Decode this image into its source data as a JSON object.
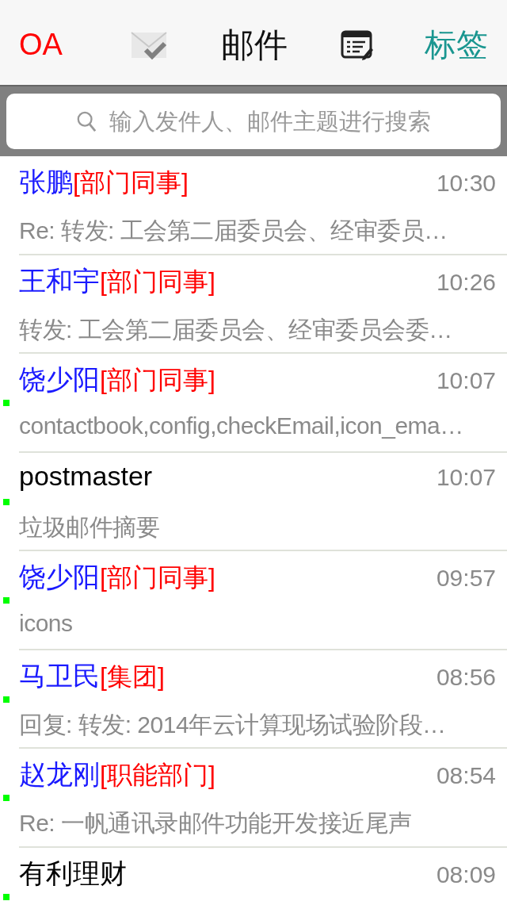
{
  "header": {
    "left": "OA",
    "title": "邮件",
    "right": "标签"
  },
  "search": {
    "placeholder": "输入发件人、邮件主题进行搜索"
  },
  "mails": [
    {
      "sender": "张鹏",
      "kind": "colleague",
      "tag": "[部门同事]",
      "time": "10:30",
      "preview": "Re: 转发: 工会第二届委员会、经审委员…",
      "unread": false
    },
    {
      "sender": "王和宇",
      "kind": "colleague",
      "tag": "[部门同事]",
      "time": "10:26",
      "preview": "转发: 工会第二届委员会、经审委员会委…",
      "unread": false
    },
    {
      "sender": "饶少阳",
      "kind": "colleague",
      "tag": "[部门同事]",
      "time": "10:07",
      "preview": "contactbook,config,checkEmail,icon_ema…",
      "unread": true
    },
    {
      "sender": "postmaster",
      "kind": "external",
      "time": "10:07",
      "preview": "垃圾邮件摘要",
      "unread": true
    },
    {
      "sender": "饶少阳",
      "kind": "colleague",
      "tag": "[部门同事]",
      "time": "09:57",
      "preview": "icons",
      "unread": true
    },
    {
      "sender": "马卫民",
      "kind": "colleague",
      "tag": "[集团]",
      "time": "08:56",
      "preview": "回复: 转发: 2014年云计算现场试验阶段…",
      "unread": true
    },
    {
      "sender": "赵龙刚",
      "kind": "colleague",
      "tag": "[职能部门]",
      "time": "08:54",
      "preview": "Re: 一帆通讯录邮件功能开发接近尾声",
      "unread": true
    },
    {
      "sender": "有利理财",
      "kind": "external",
      "time": "08:09",
      "unread": true
    }
  ]
}
